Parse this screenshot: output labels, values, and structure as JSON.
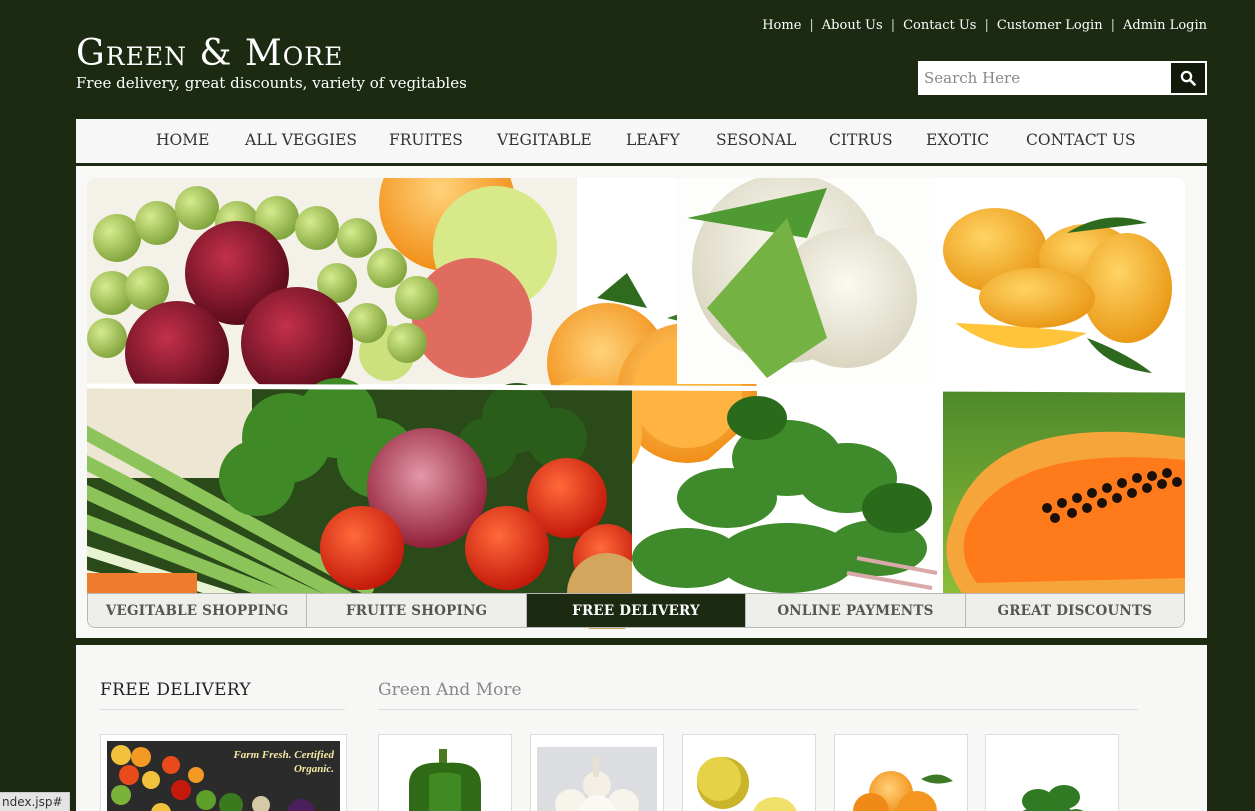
{
  "toplinks": [
    {
      "label": "Home"
    },
    {
      "label": "About Us"
    },
    {
      "label": "Contact Us"
    },
    {
      "label": "Customer Login"
    },
    {
      "label": "Admin Login"
    }
  ],
  "logo": {
    "title": "Green & More",
    "tagline": "Free delivery, great discounts, variety of vegitables"
  },
  "search": {
    "placeholder": "Search Here",
    "icon": "search-icon"
  },
  "nav": {
    "items": [
      {
        "label": "HOME"
      },
      {
        "label": "ALL VEGGIES"
      },
      {
        "label": "FRUITES"
      },
      {
        "label": "VEGITABLE"
      },
      {
        "label": "LEAFY"
      },
      {
        "label": "SESONAL"
      },
      {
        "label": "CITRUS"
      },
      {
        "label": "EXOTIC"
      },
      {
        "label": "CONTACT US"
      }
    ]
  },
  "banner": {
    "tabs": [
      {
        "label": "VEGITABLE SHOPPING",
        "active": false
      },
      {
        "label": "FRUITE SHOPING",
        "active": false
      },
      {
        "label": "FREE DELIVERY",
        "active": true
      },
      {
        "label": "ONLINE PAYMENTS",
        "active": false
      },
      {
        "label": "GREAT DISCOUNTS",
        "active": false
      }
    ]
  },
  "content": {
    "free_delivery_title": "FREE DELIVERY",
    "free_delivery_card_text": "Farm Fresh. Certified Organic.",
    "section_title": "Green And More",
    "products": [
      {
        "name": "green-pepper"
      },
      {
        "name": "garlic"
      },
      {
        "name": "lemon"
      },
      {
        "name": "orange"
      },
      {
        "name": "leafy-greens"
      }
    ]
  },
  "status": {
    "url": "ndex.jsp#"
  },
  "colors": {
    "brand_dark": "#1c2a12",
    "nav_bg": "#f7f7f7"
  }
}
